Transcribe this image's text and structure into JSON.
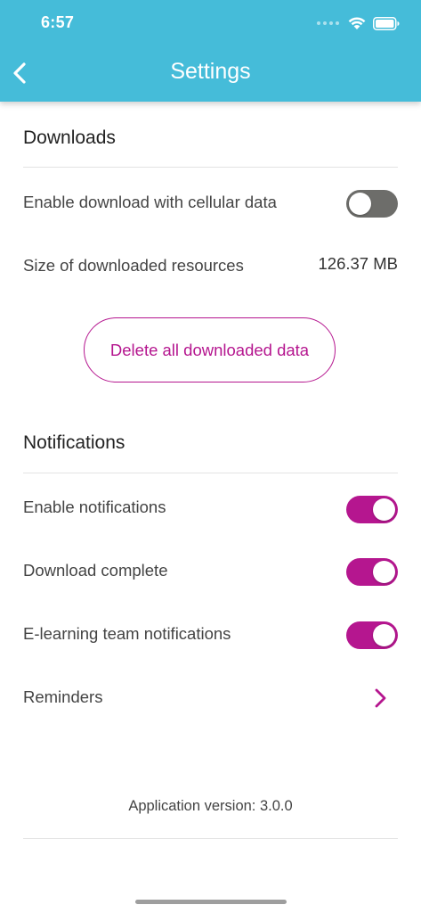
{
  "status_bar": {
    "time": "6:57"
  },
  "header": {
    "title": "Settings",
    "back_icon": "chevron-left-icon",
    "background": "#45bcd9"
  },
  "downloads": {
    "section_title": "Downloads",
    "cellular_label": "Enable download with cellular data",
    "cellular_enabled": false,
    "size_label": "Size of downloaded resources",
    "size_value": "126.37 MB",
    "delete_button_label": "Delete all downloaded data"
  },
  "notifications": {
    "section_title": "Notifications",
    "items": [
      {
        "label": "Enable notifications",
        "enabled": true
      },
      {
        "label": "Download complete",
        "enabled": true
      },
      {
        "label": "E-learning team notifications",
        "enabled": true
      }
    ],
    "reminders_label": "Reminders"
  },
  "footer": {
    "version_text": "Application version: 3.0.0"
  },
  "colors": {
    "accent": "#b5168f",
    "toggle_off": "#6d6d6a",
    "header": "#45bcd9"
  }
}
